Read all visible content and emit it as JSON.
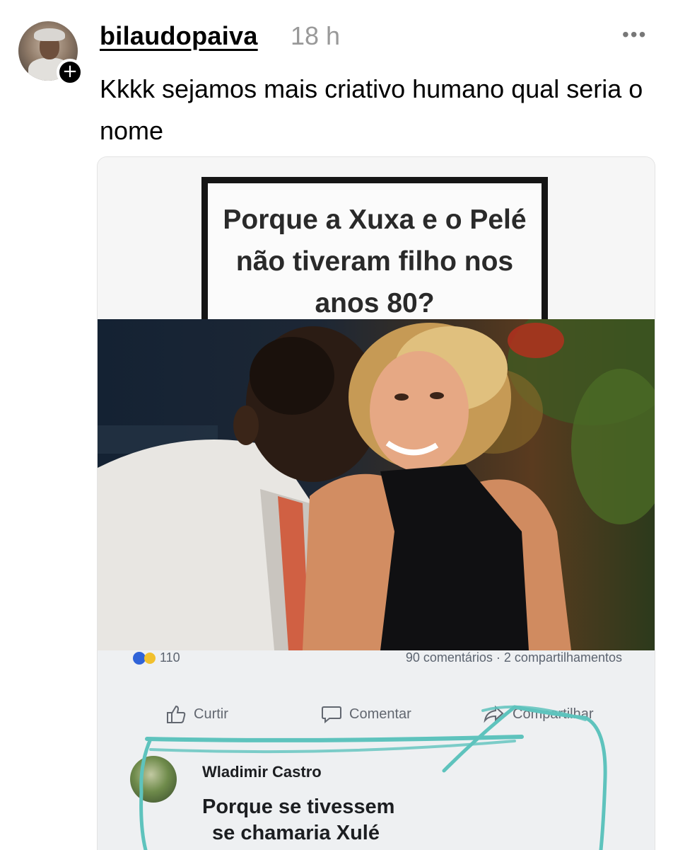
{
  "post": {
    "username": "bilaudopaiva",
    "time": "18 h",
    "more_label": "•••",
    "follow_symbol": "+",
    "text": "Kkkk sejamos mais criativo humano qual seria o nome"
  },
  "meme": {
    "caption": "Porque a Xuxa e o Pelé não tiveram filho nos anos 80?"
  },
  "facebook": {
    "reaction_count": "110",
    "stats": "90 comentários · 2 compartilhamentos",
    "actions": {
      "like": "Curtir",
      "comment": "Comentar",
      "share": "Compartilhar"
    },
    "comment": {
      "author": "Wladimir Castro",
      "text_line1": "Porque se tivessem",
      "text_line2": "se chamaria Xulé"
    }
  },
  "colors": {
    "scribble": "#5ec3bd",
    "timestamp": "#999999",
    "facebook_gray": "#626770"
  }
}
